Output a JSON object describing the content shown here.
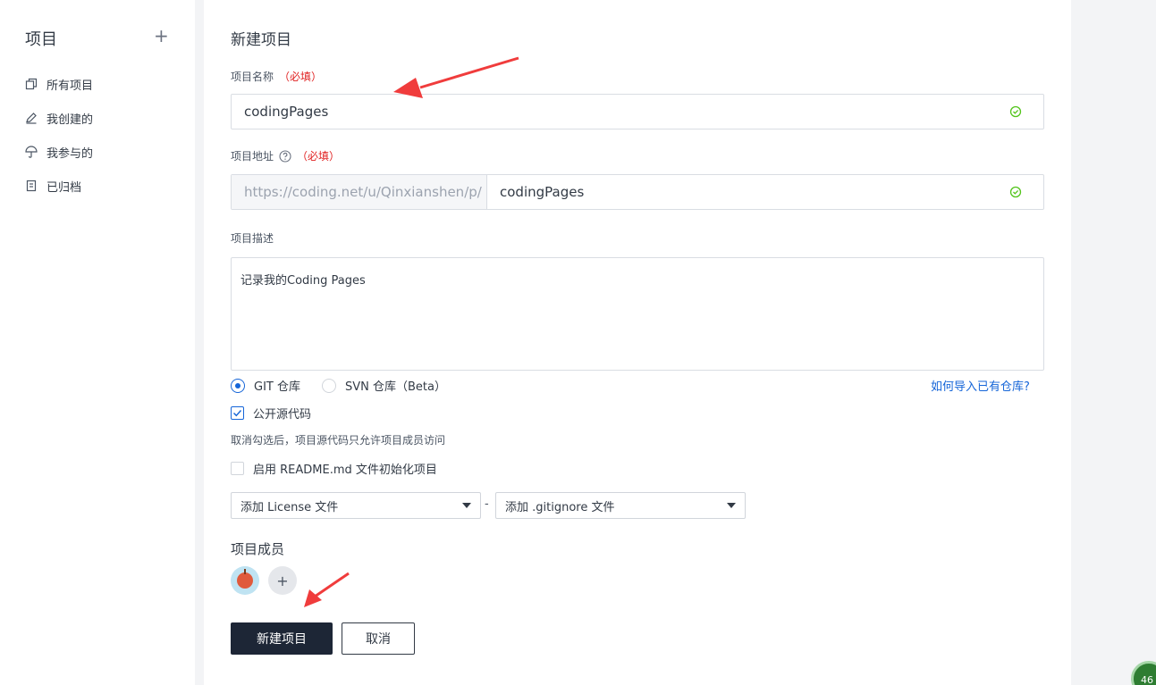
{
  "sidebar": {
    "title": "项目",
    "add_label": "+",
    "items": [
      {
        "label": "所有项目",
        "icon": "copy-icon"
      },
      {
        "label": "我创建的",
        "icon": "pencil-icon"
      },
      {
        "label": "我参与的",
        "icon": "umbrella-icon"
      },
      {
        "label": "已归档",
        "icon": "archive-icon"
      }
    ]
  },
  "form": {
    "title": "新建项目",
    "name": {
      "label": "项目名称",
      "required": "（必填）",
      "value": "codingPages"
    },
    "address": {
      "label": "项目地址",
      "required": "（必填）",
      "prefix": "https://coding.net/u/Qinxianshen/p/",
      "value": "codingPages"
    },
    "description": {
      "label": "项目描述",
      "value": "记录我的Coding Pages"
    },
    "repo_type": {
      "options": [
        "GIT 仓库",
        "SVN 仓库（Beta）"
      ],
      "selected": "GIT 仓库",
      "import_link": "如何导入已有仓库?"
    },
    "public_source": {
      "label": "公开源代码",
      "checked": true,
      "hint": "取消勾选后，项目源代码只允许项目成员访问"
    },
    "readme": {
      "label": "启用 README.md 文件初始化项目",
      "checked": false
    },
    "license_select": "添加 License 文件",
    "separator": "-",
    "gitignore_select": "添加 .gitignore 文件",
    "members_title": "项目成员",
    "add_member": "+",
    "submit_label": "新建项目",
    "cancel_label": "取消"
  },
  "badge": {
    "text": "46"
  },
  "colors": {
    "accent": "#1565d8",
    "primary_button": "#1d2636",
    "required": "#e02020",
    "success": "#52c41a",
    "annotation_arrow": "#f03c3c"
  }
}
